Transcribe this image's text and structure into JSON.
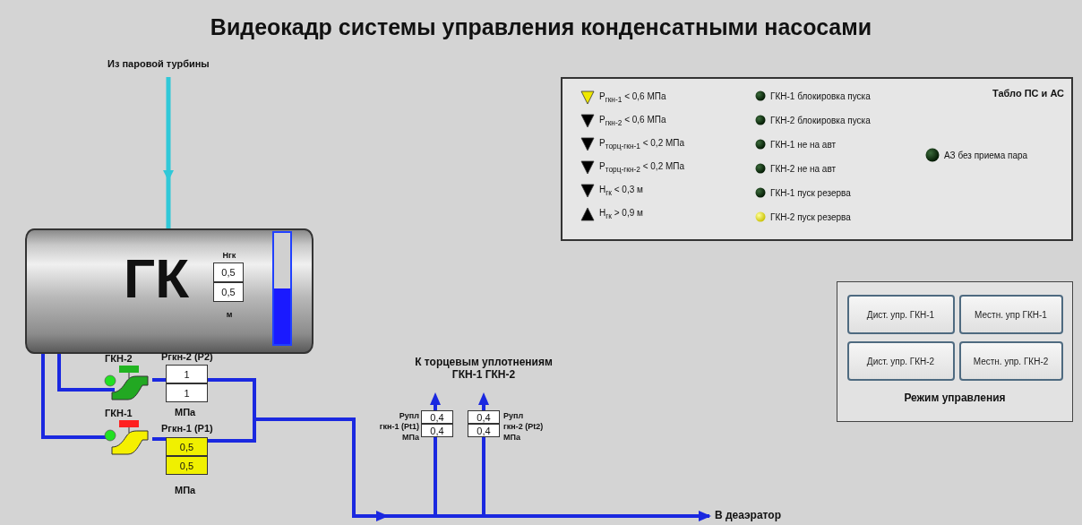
{
  "title": "Видеокадр системы управления конденсатными насосами",
  "inlet": {
    "label": "Из паровой турбины"
  },
  "tank": {
    "label": "ГК",
    "level_label": "Нгк",
    "values": [
      "0,5",
      "0,5"
    ],
    "unit": "м",
    "level": 0.5
  },
  "pumps": [
    {
      "name": "ГКН-2",
      "running": true,
      "alarm": false,
      "pressure_label": "Ргкн-2 (Р2)",
      "values": [
        "1",
        "1"
      ],
      "unit": "МПа"
    },
    {
      "name": "ГКН-1",
      "running": false,
      "alarm": true,
      "pressure_label": "Ргкн-1 (Р1)",
      "values": [
        "0,5",
        "0,5"
      ],
      "unit": "МПа"
    }
  ],
  "seals": {
    "title_lines": [
      "К торцевым уплотнениям",
      "ГКН-1 ГКН-2"
    ],
    "gauges": [
      {
        "label_lines": [
          "Рупл",
          "гкн-1 (Pt1)",
          "МПа"
        ],
        "values": [
          "0,4",
          "0,4"
        ]
      },
      {
        "label_lines": [
          "Рупл",
          "гкн-2 (Pt2)",
          "МПа"
        ],
        "values": [
          "0,4",
          "0,4"
        ]
      }
    ]
  },
  "outlet": {
    "label": "В деаэратор"
  },
  "alarm_panel": {
    "title": "Табло ПС и АС",
    "thresholds": [
      {
        "text": "Р$_{гкн-1}$ < 0,6 МПа",
        "kind": "low",
        "active": true
      },
      {
        "text": "Р$_{гкн-2}$ < 0,6 МПа",
        "kind": "low",
        "active": false
      },
      {
        "text": "Р$_{торц-гкн-1}$ < 0,2 МПа",
        "kind": "low",
        "active": false
      },
      {
        "text": "Р$_{торц-гкн-2}$ < 0,2 МПа",
        "kind": "low",
        "active": false
      },
      {
        "text": "Н$_{гк}$ < 0,3 м",
        "kind": "low",
        "active": false
      },
      {
        "text": "Н$_{гк}$ > 0,9 м",
        "kind": "high",
        "active": false
      }
    ],
    "lamps": [
      {
        "text": "ГКН-1 блокировка пуска",
        "active": false
      },
      {
        "text": "ГКН-2 блокировка пуска",
        "active": false
      },
      {
        "text": "ГКН-1 не на авт",
        "active": false
      },
      {
        "text": "ГКН-2 не на авт",
        "active": false
      },
      {
        "text": "ГКН-1 пуск резерва",
        "active": false
      },
      {
        "text": "ГКН-2 пуск резерва",
        "active": true
      }
    ],
    "protection": {
      "text": "АЗ без приема пара",
      "active": false
    }
  },
  "control_panel": {
    "buttons": [
      "Дист. упр. ГКН-1",
      "Местн. упр ГКН-1",
      "Дист. упр. ГКН-2",
      "Местн. упр. ГКН-2"
    ],
    "title": "Режим управления"
  }
}
